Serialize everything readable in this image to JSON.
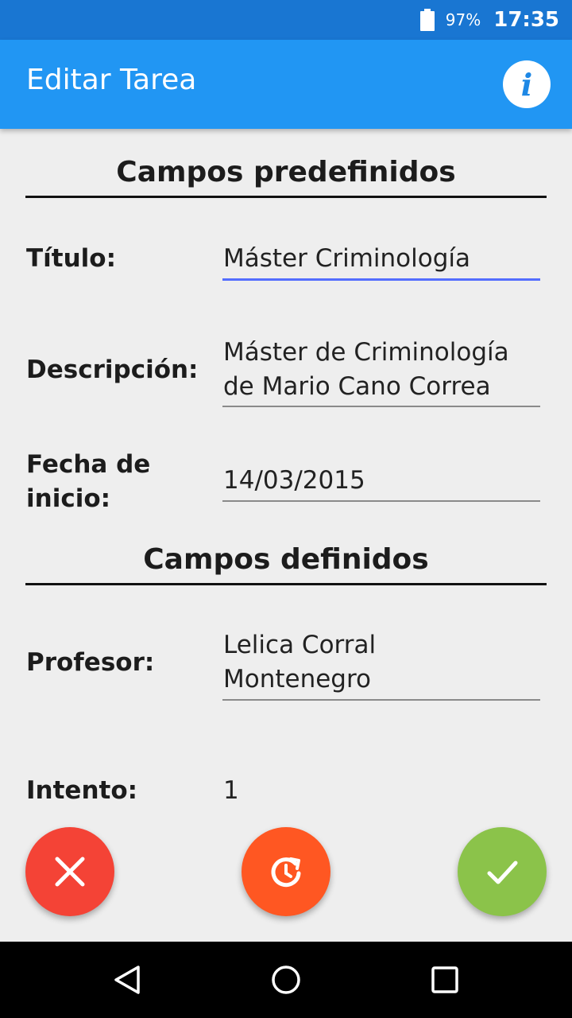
{
  "status_bar": {
    "battery": "97%",
    "time": "17:35"
  },
  "app_bar": {
    "title": "Editar Tarea",
    "info_icon": "info-icon"
  },
  "sections": {
    "predefined_title": "Campos predefinidos",
    "defined_title": "Campos definidos"
  },
  "fields": {
    "titulo": {
      "label": "Título:",
      "value": "Máster Criminología"
    },
    "descripcion": {
      "label": "Descripción:",
      "value_line1": "Máster de Criminología",
      "value_line2": "de Mario Cano Correa"
    },
    "fecha": {
      "label_line1": "Fecha de",
      "label_line2": "inicio:",
      "value": "14/03/2015"
    },
    "profesor": {
      "label": "Profesor:",
      "value_line1": "Lelica Corral",
      "value_line2": "Montenegro"
    },
    "intento": {
      "label": "Intento:",
      "value": "1"
    }
  },
  "actions": {
    "cancel_icon": "close-icon",
    "reset_icon": "restore-clock-icon",
    "confirm_icon": "check-icon"
  },
  "colors": {
    "status_bar": "#1976d2",
    "app_bar": "#2196f3",
    "cancel": "#f44336",
    "reset": "#ff5722",
    "confirm": "#8bc34a",
    "focus_underline": "#536dfe"
  }
}
